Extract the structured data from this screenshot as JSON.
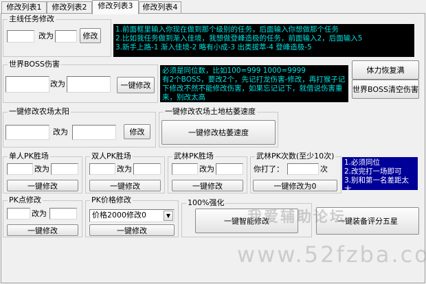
{
  "tabs": [
    "修改列表1",
    "修改列表2",
    "修改列表3",
    "修改列表4"
  ],
  "main_quest": {
    "title": "主线任务修改",
    "input1": "",
    "change_to": "改为",
    "input2": "",
    "button": "修改",
    "notes": [
      "1.前面框里输入你现在做到那个级别的任务，后面输入你想做那个任务",
      "2.比如我任务做到渐入佳境，我想做登峰造极的任务，前面输入2，后面输入5",
      "3.新手上路-1 渐入佳境-2 略有小成-3 出类拔萃-4 登峰造极-5"
    ]
  },
  "boss_damage": {
    "title": "世界BOSS伤害",
    "input1": "",
    "change_to": "改为",
    "input2": "",
    "button": "一键修改",
    "notes": [
      "必须是同位数，比如100=999 1000=9999",
      "有2个BOSS，要改2个，先记打龙伤害-修改，再打猴子记下修改不然不能修改伤害，如果忘记记下，就借说伤害重来，别改太高"
    ]
  },
  "side_buttons": {
    "stamina": "体力恢复满",
    "boss_clear": "世界BOSS清空伤害"
  },
  "farm_sun": {
    "title": "一键修改农场太阳",
    "input1": "",
    "change_to": "改为",
    "input2": "",
    "button": "修改"
  },
  "farm_wither": {
    "title": "一键修改农场土地枯萎速度",
    "button": "一键修改枯萎速度"
  },
  "pk_single": {
    "title": "单人PK胜场",
    "input1": "",
    "change_to": "改为",
    "input2": "",
    "button": "一键修改"
  },
  "pk_double": {
    "title": "双人PK胜场",
    "input1": "",
    "change_to": "改为",
    "input2": "",
    "button": "一键修改"
  },
  "pk_wulin": {
    "title": "武林PK胜场",
    "input1": "",
    "change_to": "改为",
    "input2": "",
    "button": "一键修改"
  },
  "pk_count": {
    "title": "武林PK次数(至少10次)",
    "prefix": "你打了：",
    "input": "",
    "suffix": "次",
    "button": "一键修改为0",
    "notes": [
      "1.必须同位",
      "2.改完打一场即可",
      "3.别和第一名差距太大"
    ]
  },
  "pk_points": {
    "title": "PK点修改",
    "input1": "",
    "change_to": "改为",
    "input2": "",
    "button": "一键修改"
  },
  "pk_price": {
    "title": "PK价格修改",
    "select_value": "价格2000修改0",
    "button": "一键修改"
  },
  "enhance": {
    "title": "100%强化",
    "button": "一键智能修改"
  },
  "equip_button": "一键装备评分五星",
  "watermark": {
    "line1": "我爱辅助论坛",
    "line2": "www.52fzba.com"
  }
}
